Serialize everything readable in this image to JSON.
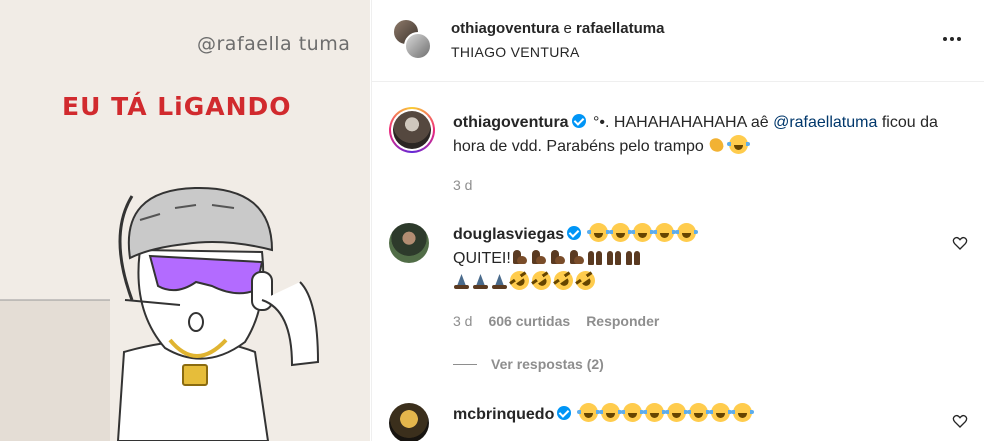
{
  "media": {
    "handle_text": "@rafaella tuma",
    "shout_text": "EU TÁ LiGANDO"
  },
  "header": {
    "user1": "othiagoventura",
    "conjunction": "e",
    "user2": "rafaellatuma",
    "subtitle": "THIAGO VENTURA",
    "more_icon": "more-horizontal-icon"
  },
  "caption": {
    "username": "othiagoventura",
    "prefix": "°•. HAHAHAHAHAHA aê",
    "mention": "@rafaellatuma",
    "text": "ficou da hora de vdd. Parabéns pelo trampo",
    "emoji": [
      "clap",
      "tears"
    ],
    "timestamp": "3 d"
  },
  "comments": [
    {
      "username": "douglasviegas",
      "line1_emoji": [
        "tears",
        "tears",
        "tears",
        "tears",
        "tears"
      ],
      "line2_text": "QUITEI!",
      "line2_emoji": [
        "muscle",
        "muscle",
        "muscle",
        "muscle",
        "raise",
        "raise",
        "raise"
      ],
      "line3_emoji": [
        "pray",
        "pray",
        "pray",
        "rofl",
        "rofl",
        "rofl",
        "rofl"
      ],
      "timestamp": "3 d",
      "likes": "606 curtidas",
      "reply": "Responder",
      "view_replies": "Ver respostas (2)"
    },
    {
      "username": "mcbrinquedo",
      "line1_emoji": [
        "tears",
        "tears",
        "tears",
        "tears",
        "tears",
        "tears",
        "tears",
        "tears"
      ]
    }
  ],
  "colors": {
    "verified": "#0095f6",
    "muted": "#8e8e8e",
    "mention": "#00376b",
    "shout": "#d12a2e",
    "media_bg": "#f1ece6"
  }
}
